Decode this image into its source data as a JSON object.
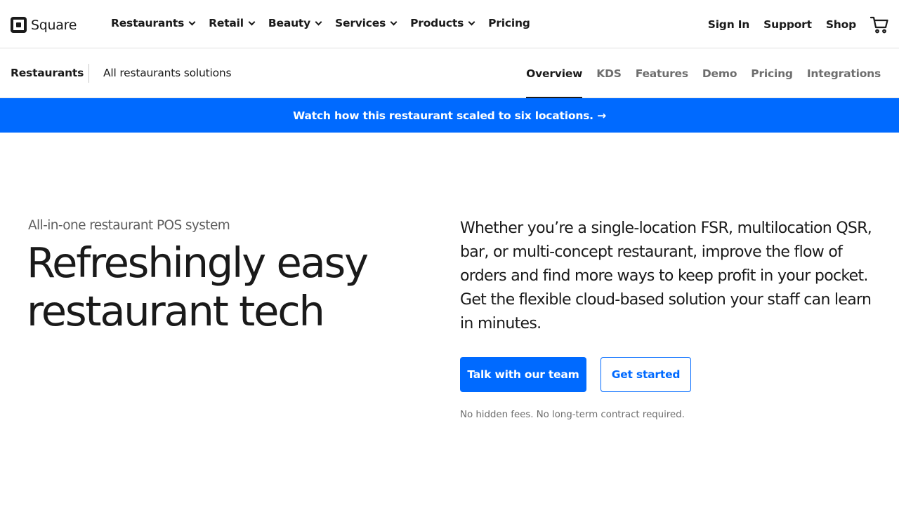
{
  "header": {
    "logo_text": "Square",
    "menu": [
      {
        "label": "Restaurants",
        "has_dropdown": true
      },
      {
        "label": "Retail",
        "has_dropdown": true
      },
      {
        "label": "Beauty",
        "has_dropdown": true
      },
      {
        "label": "Services",
        "has_dropdown": true
      },
      {
        "label": "Products",
        "has_dropdown": true
      },
      {
        "label": "Pricing",
        "has_dropdown": false
      }
    ],
    "right_links": {
      "sign_in": "Sign In",
      "support": "Support",
      "shop": "Shop"
    },
    "cart_icon": "shopping-cart-icon"
  },
  "subnav": {
    "home": "Restaurants",
    "all_solutions": "All restaurants solutions",
    "tabs": [
      {
        "label": "Overview",
        "active": true
      },
      {
        "label": "KDS",
        "active": false
      },
      {
        "label": "Features",
        "active": false
      },
      {
        "label": "Demo",
        "active": false
      },
      {
        "label": "Pricing",
        "active": false
      },
      {
        "label": "Integrations",
        "active": false
      }
    ]
  },
  "banner": {
    "text": "Watch how this restaurant scaled to six locations. →",
    "background": "#006aff"
  },
  "hero": {
    "eyebrow": "All-in-one restaurant POS system",
    "headline": "Refreshingly easy restaurant tech",
    "body": "Whether you’re a single-location FSR, multilocation QSR, bar, or multi-concept restaurant, improve the flow of orders and find more ways to keep profit in your pocket. Get the flexible cloud-based solution your staff can learn in minutes.",
    "primary_cta": "Talk with our team",
    "secondary_cta": "Get started",
    "fine_print": "No hidden fees. No long-term contract required."
  },
  "colors": {
    "accent": "#006aff",
    "text": "#1a1a1a",
    "muted": "#6e6e6e"
  }
}
